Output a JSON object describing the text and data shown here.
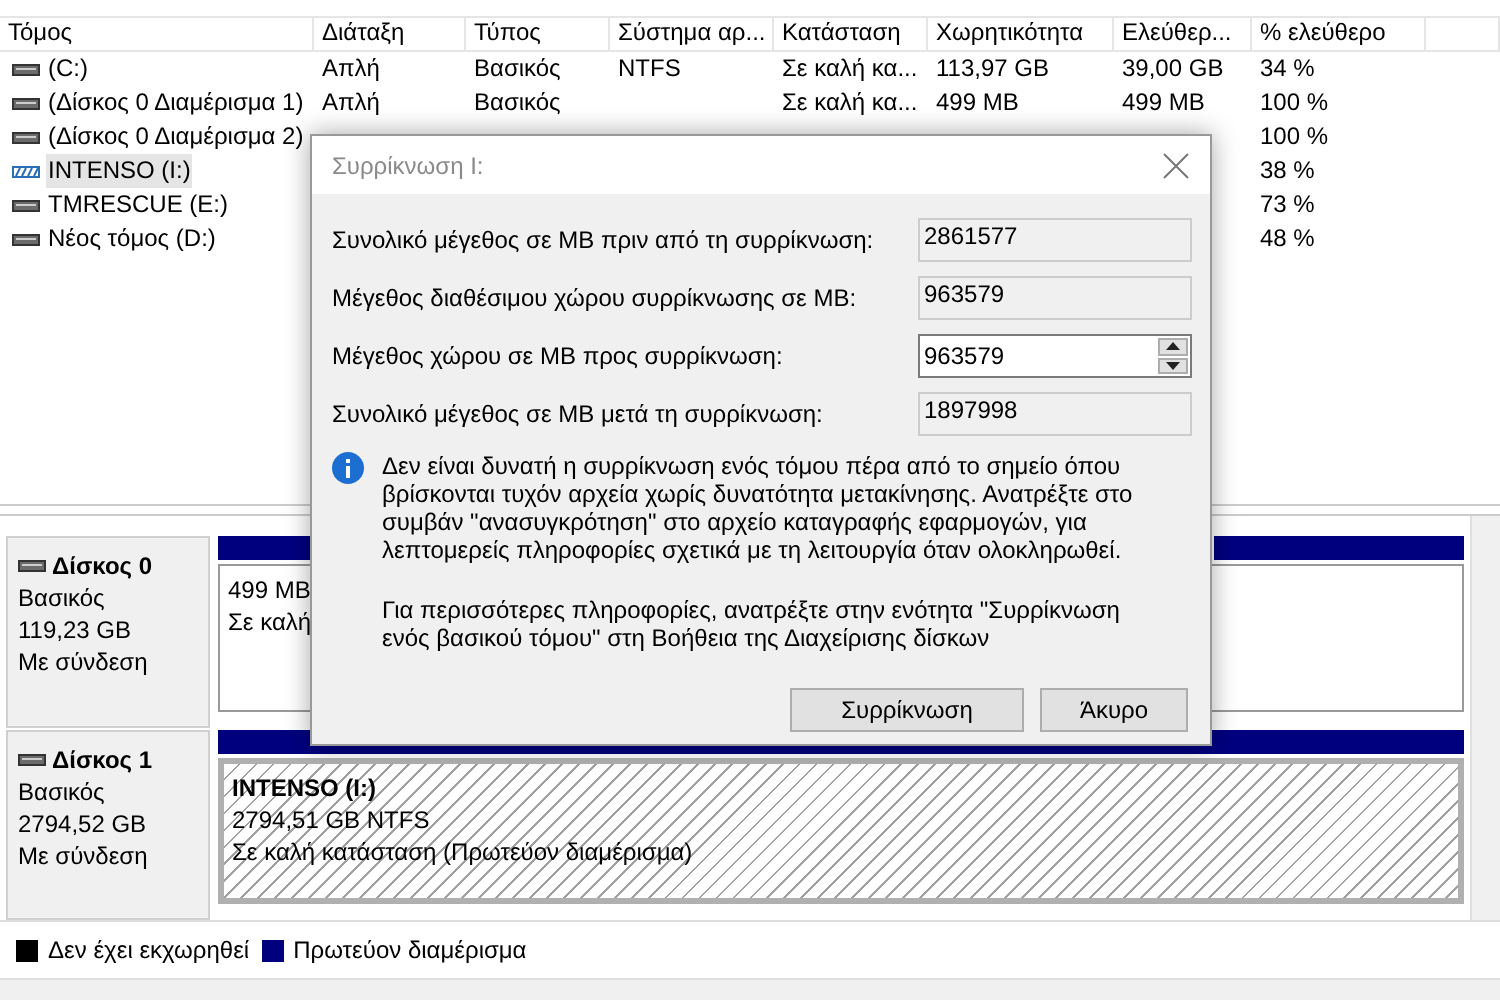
{
  "volumes_table": {
    "columns": [
      "Τόμος",
      "Διάταξη",
      "Τύπος",
      "Σύστημα αρ...",
      "Κατάσταση",
      "Χωρητικότητα",
      "Ελεύθερ...",
      "% ελεύθερο"
    ],
    "rows": [
      {
        "kind": "drive",
        "name": " (C:)",
        "layout": "Απλή",
        "type": "Βασικός",
        "file_system": "NTFS",
        "status": "Σε καλή κα...",
        "capacity": "113,97 GB",
        "free": "39,00 GB",
        "percent_free": "34 %",
        "selected": false
      },
      {
        "kind": "drive",
        "name": "(Δίσκος 0 Διαμέρισμα 1)",
        "layout": "Απλή",
        "type": "Βασικός",
        "status": "Σε καλή κα...",
        "capacity": "499 MB",
        "free": "499 MB",
        "percent_free": "100 %",
        "selected": false
      },
      {
        "kind": "drive",
        "name": "(Δίσκος 0 Διαμέρισμα 2)",
        "percent_free": "100 %",
        "selected": false
      },
      {
        "kind": "striped",
        "name": "INTENSO (I:)",
        "percent_free": "38 %",
        "selected": true
      },
      {
        "kind": "drive",
        "name": "TMRESCUE (E:)",
        "percent_free": "73 %",
        "selected": false
      },
      {
        "kind": "drive",
        "name": "Νέος τόμος (D:)",
        "percent_free": "48 %",
        "selected": false
      }
    ]
  },
  "disks": [
    {
      "name": "Δίσκος 0",
      "type": "Βασικός",
      "size": "119,23 GB",
      "status": "Με σύνδεση",
      "partitions": [
        {
          "kind": "primary",
          "lines": [
            "499 MB",
            "Σε καλή"
          ]
        }
      ]
    },
    {
      "name": "Δίσκος 1",
      "type": "Βασικός",
      "size": "2794,52 GB",
      "status": "Με σύνδεση",
      "partitions": [
        {
          "kind": "hatched",
          "title": "INTENSO  (I:)",
          "lines": [
            "2794,51 GB NTFS",
            "Σε καλή κατάσταση (Πρωτεύον διαμέρισμα)"
          ]
        }
      ]
    }
  ],
  "legend": [
    {
      "label": "Δεν έχει εκχωρηθεί",
      "color": "#000000"
    },
    {
      "label": "Πρωτεύον διαμέρισμα",
      "color": "#00007f"
    }
  ],
  "dialog": {
    "title": "Συρρίκνωση I:",
    "fields": [
      {
        "kind": "readonly",
        "label": "Συνολικό μέγεθος σε MB πριν από τη συρρίκνωση:",
        "value": "2861577"
      },
      {
        "kind": "readonly",
        "label": "Μέγεθος διαθέσιμου χώρου συρρίκνωσης σε MB:",
        "value": "963579"
      },
      {
        "kind": "spinner",
        "label": "Μέγεθος χώρου σε MB προς συρρίκνωση:",
        "value": "963579"
      },
      {
        "kind": "readonly",
        "label": "Συνολικό μέγεθος σε MB μετά τη συρρίκνωση:",
        "value": "1897998"
      }
    ],
    "info": [
      "Δεν είναι δυνατή η συρρίκνωση ενός τόμου πέρα από το σημείο όπου βρίσκονται τυχόν αρχεία χωρίς δυνατότητα μετακίνησης. Ανατρέξτε στο συμβάν \"ανασυγκρότηση\" στο αρχείο καταγραφής εφαρμογών, για λεπτομερείς πληροφορίες σχετικά με τη λειτουργία όταν ολοκληρωθεί.",
      "Για περισσότερες πληροφορίες, ανατρέξτε στην ενότητα \"Συρρίκνωση ενός βασικού τόμου\" στη Βοήθεια της Διαχείρισης δίσκων"
    ],
    "buttons": [
      "Συρρίκνωση",
      "Άκυρο"
    ]
  }
}
